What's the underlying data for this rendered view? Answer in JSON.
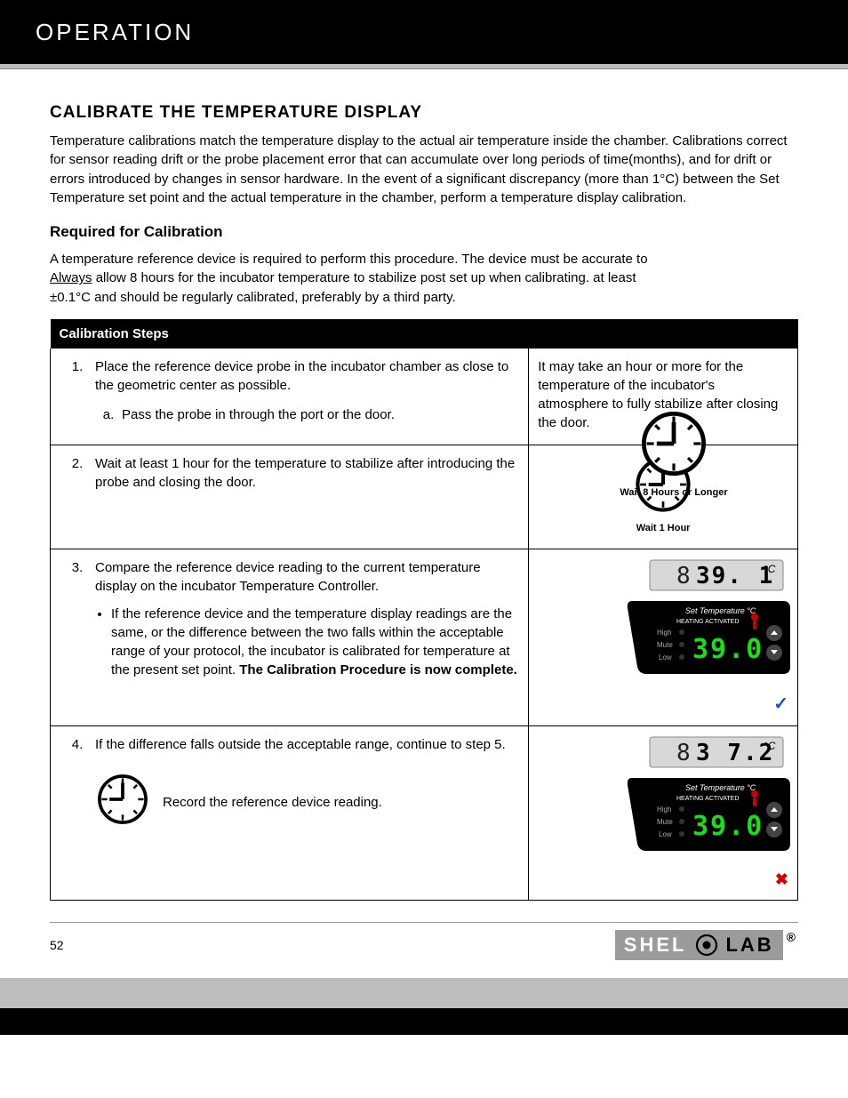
{
  "header": {
    "left": "OPERATION",
    "right": ""
  },
  "section_title": "CALIBRATE THE TEMPERATURE DISPLAY",
  "intro_p1": "Temperature calibrations match the temperature display to the actual air temperature inside the chamber. Calibrations correct for sensor reading drift or the probe placement error that can accumulate over long periods of time(months), and for drift or errors introduced by changes in sensor hardware. In the event of a significant discrepancy (more than 1°C) between the Set Temperature set point and the actual temperature in the chamber, perform a temperature display calibration.",
  "sub_title": "Required for Calibration",
  "req_p": "A temperature reference device is required to perform this procedure. The device must be accurate to ",
  "req_p_b": " at least ±0.1°",
  "req_p_c": "C and should be regularly calibrated, preferably by a third party.",
  "always_word": "Always",
  "req_p_pre": "allow 8 hours for the incubator temperature to stabilize post set up when calibrating.",
  "clock_top_label": "Wait 8 Hours or Longer",
  "table": {
    "hA": "Calibration Steps",
    "hB": "",
    "r1_no": "1.",
    "r1_txt": "Place the reference device probe in the incubator chamber as close to the geometric center as possible.",
    "r1_b_no": "a.",
    "r1_b_txt": "Pass the probe in through the port or the door.",
    "r1_icon_a": "It may take an hour or more for the temperature of the incubator's atmosphere to fully stabilize after closing the door.",
    "r2_no": "2.",
    "r2_txt": "Wait at least 1 hour for the temperature to stabilize after introducing the probe and closing the door.",
    "r2_label": "Wait 1 Hour",
    "r3_no": "3.",
    "r3_txt": "Compare the reference device reading to the current temperature display on the incubator Temperature Controller.",
    "r3_li_a": "If the reference device and the temperature display readings are the same, or the difference between the two falls within the acceptable range of your protocol, the incubator is calibrated for temperature at the present set point.",
    "r3_li_a_bold": " The Calibration Procedure is now complete.",
    "r3_panel_top": "39.1",
    "r3_panel_set": "39.0",
    "r4_no": "4.",
    "r4_txt": "If the difference falls outside the acceptable range, continue to step 5.",
    "r4_wait": "Record the reference device reading.",
    "r4_panel_top": "37.2",
    "r4_panel_set": "39.0"
  },
  "panel_labels": {
    "set": "Set Temperature °C",
    "heat": "HEATING ACTIVATED",
    "high": "High",
    "mute": "Mute",
    "low": "Low",
    "unit": "°C"
  },
  "footer": {
    "page": "52",
    "logo_a": "SHEL",
    "logo_b": "LAB"
  }
}
